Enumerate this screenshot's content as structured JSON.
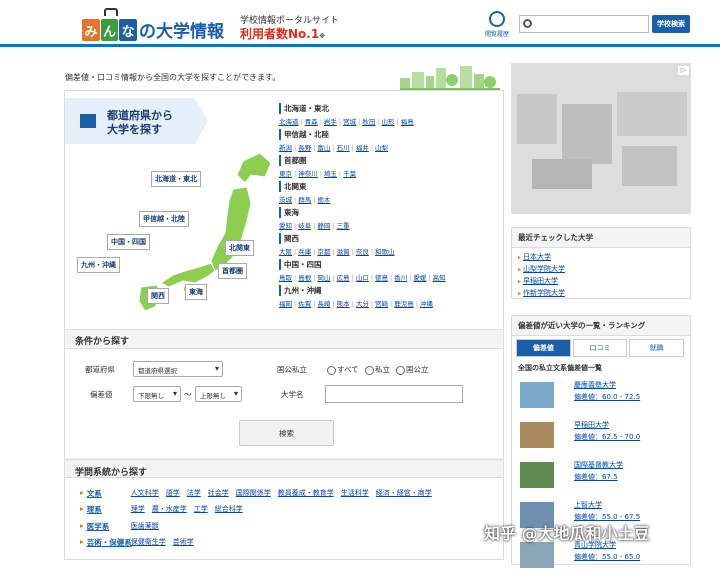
{
  "header": {
    "logo_chars": [
      "み",
      "ん",
      "な"
    ],
    "logo_text": "の大学情報",
    "tagline": "学校情報ポータルサイト",
    "slogan": "利用者数No.1",
    "slogan_note": "※",
    "history_label": "閲覧履歴",
    "search_placeholder": "",
    "search_button": "学校検索",
    "colors": {
      "logo1": "#e8732a",
      "logo2": "#3c9d3c",
      "logo3": "#1a5fa8",
      "accent": "#0b74c4"
    }
  },
  "intro": "偏差値・口コミ情報から全国の大学を探すことができます。",
  "prefecture": {
    "title_line1": "都道府県から",
    "title_line2": "大学を探す",
    "map_tags": [
      "北海道・東北",
      "甲信越・北陸",
      "中国・四国",
      "北関東",
      "九州・沖縄",
      "首都圏",
      "関西",
      "東海"
    ],
    "regions": [
      {
        "name": "北海道・東北",
        "prefs": [
          "北海道",
          "青森",
          "岩手",
          "宮城",
          "秋田",
          "山形",
          "福島"
        ]
      },
      {
        "name": "甲信越・北陸",
        "prefs": [
          "新潟",
          "長野",
          "富山",
          "石川",
          "福井",
          "山梨"
        ]
      },
      {
        "name": "首都圏",
        "prefs": [
          "東京",
          "神奈川",
          "埼玉",
          "千葉"
        ]
      },
      {
        "name": "北関東",
        "prefs": [
          "茨城",
          "群馬",
          "栃木"
        ]
      },
      {
        "name": "東海",
        "prefs": [
          "愛知",
          "岐阜",
          "静岡",
          "三重"
        ]
      },
      {
        "name": "関西",
        "prefs": [
          "大阪",
          "兵庫",
          "京都",
          "滋賀",
          "奈良",
          "和歌山"
        ]
      },
      {
        "name": "中国・四国",
        "prefs": [
          "鳥取",
          "島根",
          "岡山",
          "広島",
          "山口",
          "徳島",
          "香川",
          "愛媛",
          "高知"
        ]
      },
      {
        "name": "九州・沖縄",
        "prefs": [
          "福岡",
          "佐賀",
          "長崎",
          "熊本",
          "大分",
          "宮崎",
          "鹿児島",
          "沖縄"
        ]
      }
    ]
  },
  "conditions": {
    "title": "条件から探す",
    "pref_label": "都道府県",
    "pref_value": "都道府県選択",
    "type_label": "国公私立",
    "type_options": [
      "すべて",
      "私立",
      "国公立"
    ],
    "hensachi_label": "偏差値",
    "hensachi_low": "下限無し",
    "tilde": "～",
    "hensachi_high": "上限無し",
    "name_label": "大学名",
    "search_button": "検索"
  },
  "academic": {
    "title": "学問系統から探す",
    "rows": [
      {
        "name": "文系",
        "items": [
          "人文科学",
          "語学",
          "法学",
          "社会学",
          "国際関係学",
          "教員養成・教育学",
          "生活科学",
          "経済・経営・商学"
        ]
      },
      {
        "name": "理系",
        "items": [
          "理学",
          "農・水産学",
          "工学",
          "総合科学"
        ]
      },
      {
        "name": "医学系",
        "items": [
          "医歯薬獣"
        ]
      },
      {
        "name": "芸術・保健系",
        "items": [
          "保健衛生学",
          "芸術学"
        ]
      }
    ]
  },
  "recent": {
    "title": "最近チェックした大学",
    "items": [
      "日本大学",
      "山梨学院大学",
      "早稲田大学",
      "作新学院大学"
    ]
  },
  "ranking": {
    "title": "偏差値が近い大学の一覧・ランキング",
    "tabs": [
      "偏差値",
      "口コミ",
      "就職"
    ],
    "subtitle": "全国の私立文系偏差値一覧",
    "items": [
      {
        "name": "慶應義塾大学",
        "score": "偏差値：60.0 - 72.5"
      },
      {
        "name": "早稲田大学",
        "score": "偏差値：62.5 - 70.0"
      },
      {
        "name": "国際基督教大学",
        "score": "偏差値：67.5"
      },
      {
        "name": "上智大学",
        "score": "偏差値：55.0 - 67.5"
      },
      {
        "name": "青山学院大学",
        "score": "偏差値：55.0 - 65.0"
      }
    ]
  },
  "watermark": "知乎 @大地瓜和小土豆"
}
